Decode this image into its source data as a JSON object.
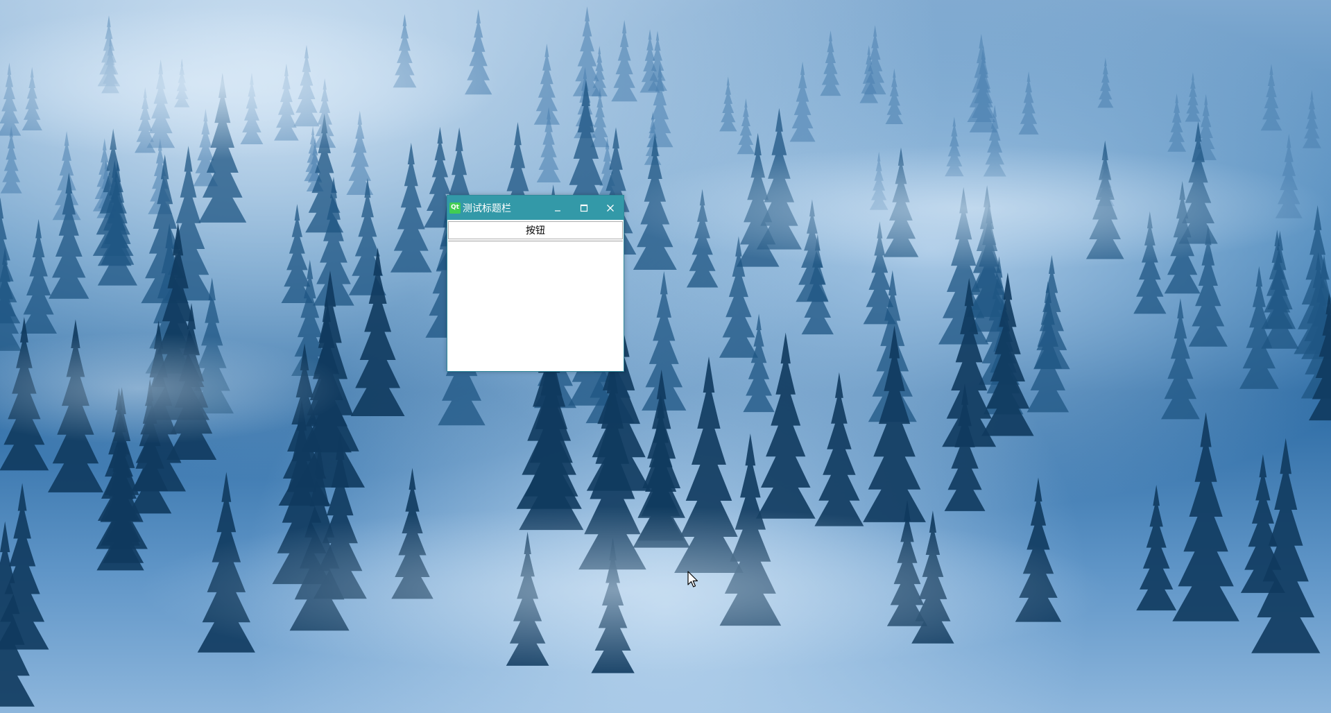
{
  "desktop": {
    "wallpaper": "misty-blue-pine-forest",
    "accent_colors": [
      "#2b6aa3",
      "#7fa9d0",
      "#0f3a5e"
    ]
  },
  "window": {
    "title": "测试标题栏",
    "app_icon": "qt-logo-icon",
    "app_icon_text": "Qt",
    "titlebar_color": "#3399a8",
    "controls": {
      "minimize": "minimize-icon",
      "maximize": "maximize-icon",
      "close": "close-icon"
    },
    "button_label": "按钮"
  },
  "cursor": {
    "icon": "arrow-cursor-icon"
  }
}
